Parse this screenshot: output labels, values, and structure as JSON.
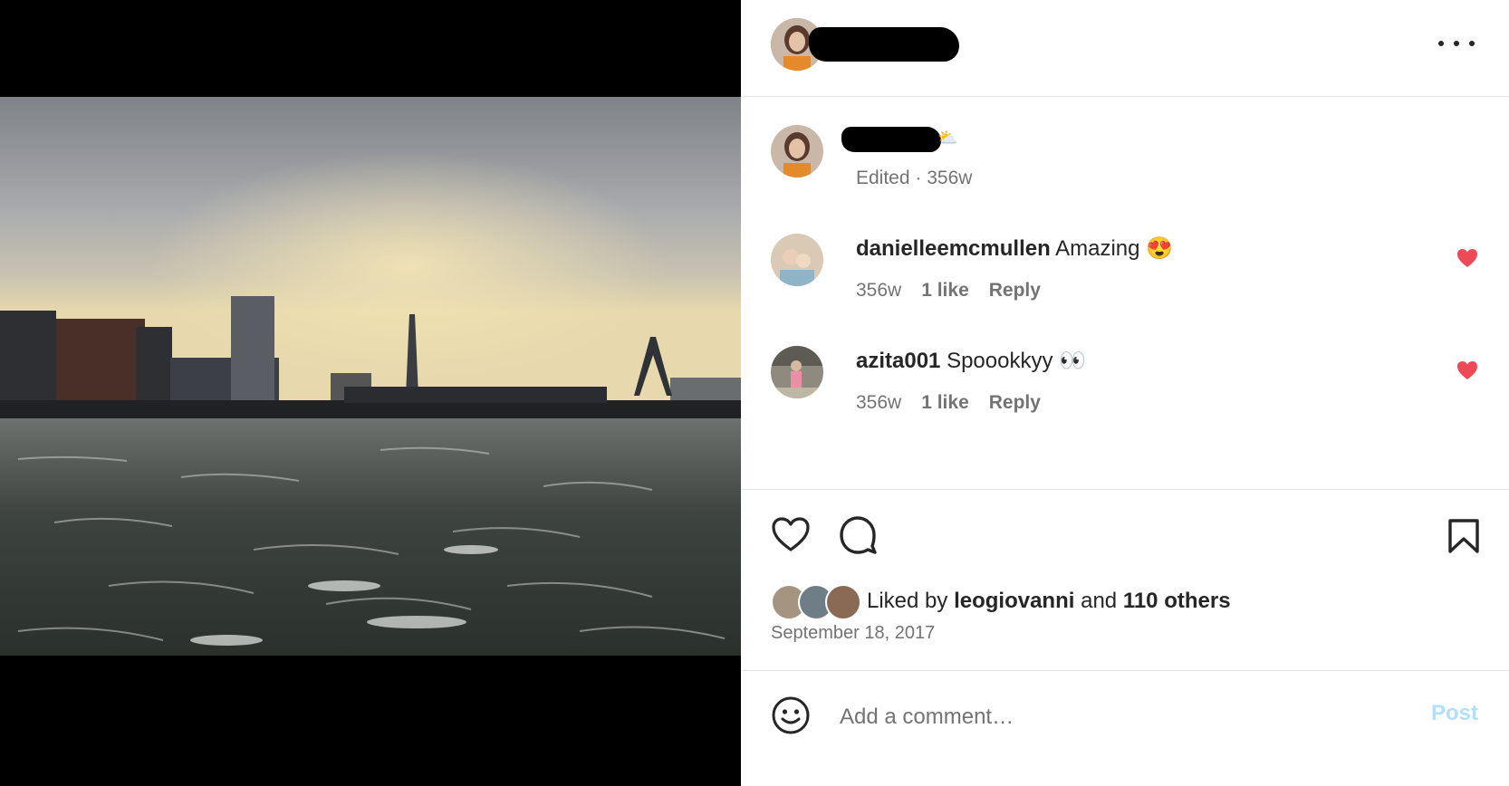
{
  "post": {
    "image_description_icon": "harbor-skyline-photo",
    "author_name_redacted": true
  },
  "caption": {
    "meta": "Edited · 356w"
  },
  "comments": [
    {
      "username": "danielleemcmullen",
      "text": "Amazing",
      "emoji": "😍",
      "age": "356w",
      "likes": "1 like",
      "reply": "Reply"
    },
    {
      "username": "azita001",
      "text": "Spoookkyy",
      "emoji": "👀",
      "age": "356w",
      "likes": "1 like",
      "reply": "Reply"
    }
  ],
  "likes": {
    "prefix": "Liked by",
    "user": "leogiovanni",
    "joiner": "and",
    "others": "110 others"
  },
  "date": "September 18, 2017",
  "comment_box": {
    "placeholder": "Add a comment…",
    "post_label": "Post"
  },
  "colors": {
    "heart_red": "#ed4956",
    "post_disabled": "#b2dffc",
    "muted_text": "#737373"
  }
}
